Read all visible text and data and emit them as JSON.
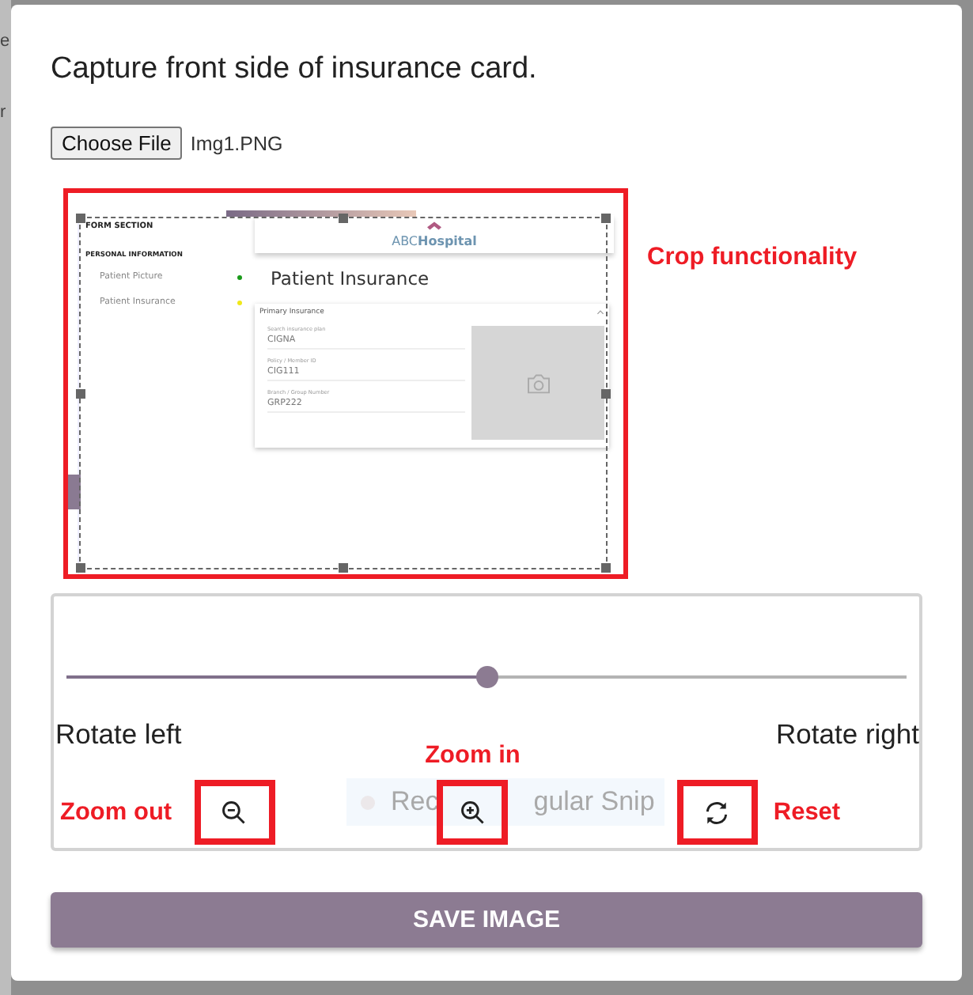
{
  "background_fragments": [
    "e",
    "r"
  ],
  "dialog": {
    "title": "Capture front side of insurance card.",
    "file_button": "Choose File",
    "file_name": "Img1.PNG",
    "crop_note": "Crop functionality",
    "preview": {
      "section_title": "FORM SECTION",
      "group_title": "PERSONAL INFORMATION",
      "nav_items": [
        {
          "label": "Patient Picture",
          "color": "#1a9a1a"
        },
        {
          "label": "Patient Insurance",
          "color": "#f0e81a"
        }
      ],
      "logo": "ABC**Hospital**",
      "page_title": "Patient Insurance",
      "card_title": "Primary Insurance",
      "fields": [
        {
          "label": "Search insurance plan",
          "value": "CIGNA"
        },
        {
          "label": "Policy / Member ID",
          "value": "CIG111"
        },
        {
          "label": "Branch / Group Number",
          "value": "GRP222"
        }
      ]
    },
    "rotate": {
      "level": 0.5,
      "left_label": "Rotate left",
      "right_label": "Rotate right"
    },
    "snip_hint": [
      "Rec",
      "gular Snip"
    ],
    "tools": [
      {
        "kind": "zoom-out",
        "note": "Zoom out"
      },
      {
        "kind": "zoom-in",
        "note": "Zoom in"
      },
      {
        "kind": "reset",
        "note": "Reset"
      }
    ],
    "save_button": "SAVE IMAGE"
  }
}
